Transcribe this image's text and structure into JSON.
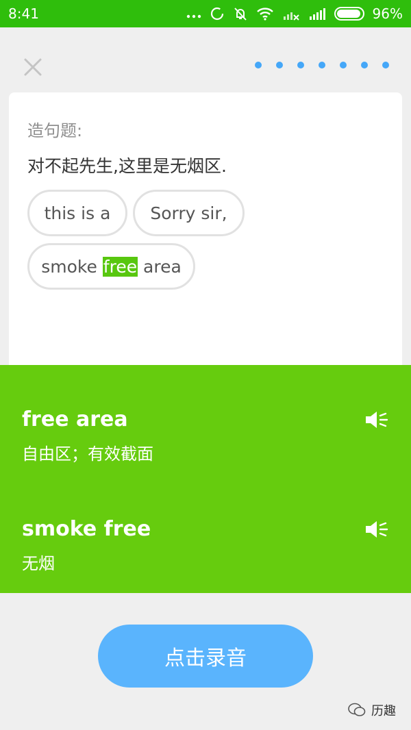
{
  "status_bar": {
    "time": "8:41",
    "battery_percent": "96%",
    "battery_level": 0.96
  },
  "header": {
    "progress_dots_count": 7,
    "accent_color": "#45a7f8"
  },
  "question": {
    "label": "造句题:",
    "sentence": "对不起先生,这里是无烟区.",
    "chips": [
      {
        "text": "this is a"
      },
      {
        "text": "Sorry sir,"
      },
      {
        "before": "smoke ",
        "highlight": "free",
        "after": " area"
      }
    ]
  },
  "suggestions": [
    {
      "phrase": "free area",
      "meaning": "自由区；有效截面"
    },
    {
      "phrase": "smoke free",
      "meaning": "无烟"
    }
  ],
  "record_button": {
    "label": "点击录音"
  },
  "watermark": {
    "text": "历趣"
  },
  "colors": {
    "status_green": "#2fbe0c",
    "panel_green": "#66cc0e",
    "button_blue": "#5ab4fd"
  }
}
